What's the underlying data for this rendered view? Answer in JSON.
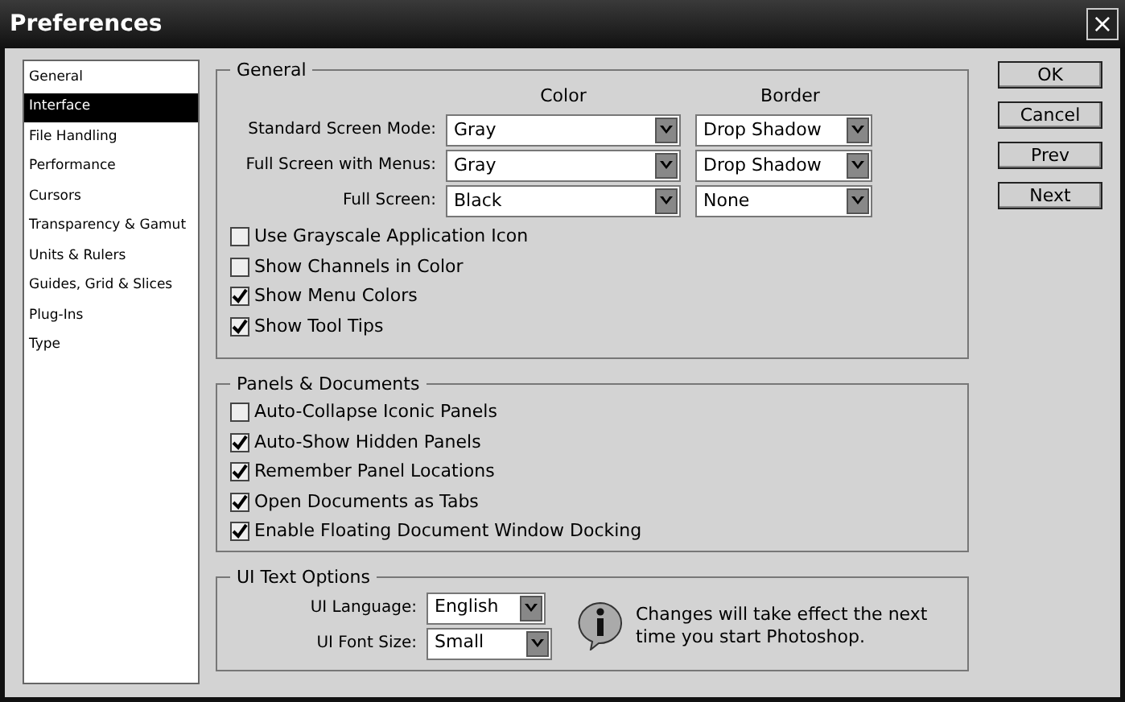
{
  "window": {
    "title": "Preferences",
    "close": "×"
  },
  "sidebar": {
    "items": [
      {
        "label": "General",
        "selected": false
      },
      {
        "label": "Interface",
        "selected": true
      },
      {
        "label": "File Handling",
        "selected": false
      },
      {
        "label": "Performance",
        "selected": false
      },
      {
        "label": "Cursors",
        "selected": false
      },
      {
        "label": "Transparency & Gamut",
        "selected": false
      },
      {
        "label": "Units & Rulers",
        "selected": false
      },
      {
        "label": "Guides, Grid & Slices",
        "selected": false
      },
      {
        "label": "Plug-Ins",
        "selected": false
      },
      {
        "label": "Type",
        "selected": false
      }
    ]
  },
  "general": {
    "title": "General",
    "columns": [
      "Color",
      "Border"
    ],
    "modes": [
      {
        "label": "Standard Screen Mode:",
        "color_mode": "Gray",
        "border_mode": "Drop Shadow"
      },
      {
        "label": "Full Screen with Menus:",
        "color_mode": "Gray",
        "border_mode": "Drop Shadow"
      },
      {
        "label": "Full Screen:",
        "color_mode": "Black",
        "border_mode": "None"
      }
    ],
    "options": [
      {
        "label": "Use Grayscale Application Icon",
        "checked": false
      },
      {
        "label": "Show Channels in Color",
        "checked": false
      },
      {
        "label": "Show Menu Colors",
        "checked": true
      },
      {
        "label": "Show Tool Tips",
        "checked": true
      }
    ]
  },
  "panels_documents": {
    "title": "Panels & Documents",
    "options": [
      {
        "label": "Auto-Collapse Iconic Panels",
        "checked": false
      },
      {
        "label": "Auto-Show Hidden Panels",
        "checked": true
      },
      {
        "label": "Remember Panel Locations",
        "checked": true
      },
      {
        "label": "Open Documents as Tabs",
        "checked": true
      },
      {
        "label": "Enable Floating Document Window Docking",
        "checked": true
      }
    ]
  },
  "ui_text_options": {
    "title": "UI Text Options",
    "fields": [
      {
        "label": "UI Language:",
        "value": "English"
      },
      {
        "label": "UI Font Size:",
        "value": "Small"
      }
    ],
    "note": "Changes will take effect the next time you start Photoshop."
  },
  "buttons": [
    "OK",
    "Cancel",
    "Prev",
    "Next"
  ]
}
